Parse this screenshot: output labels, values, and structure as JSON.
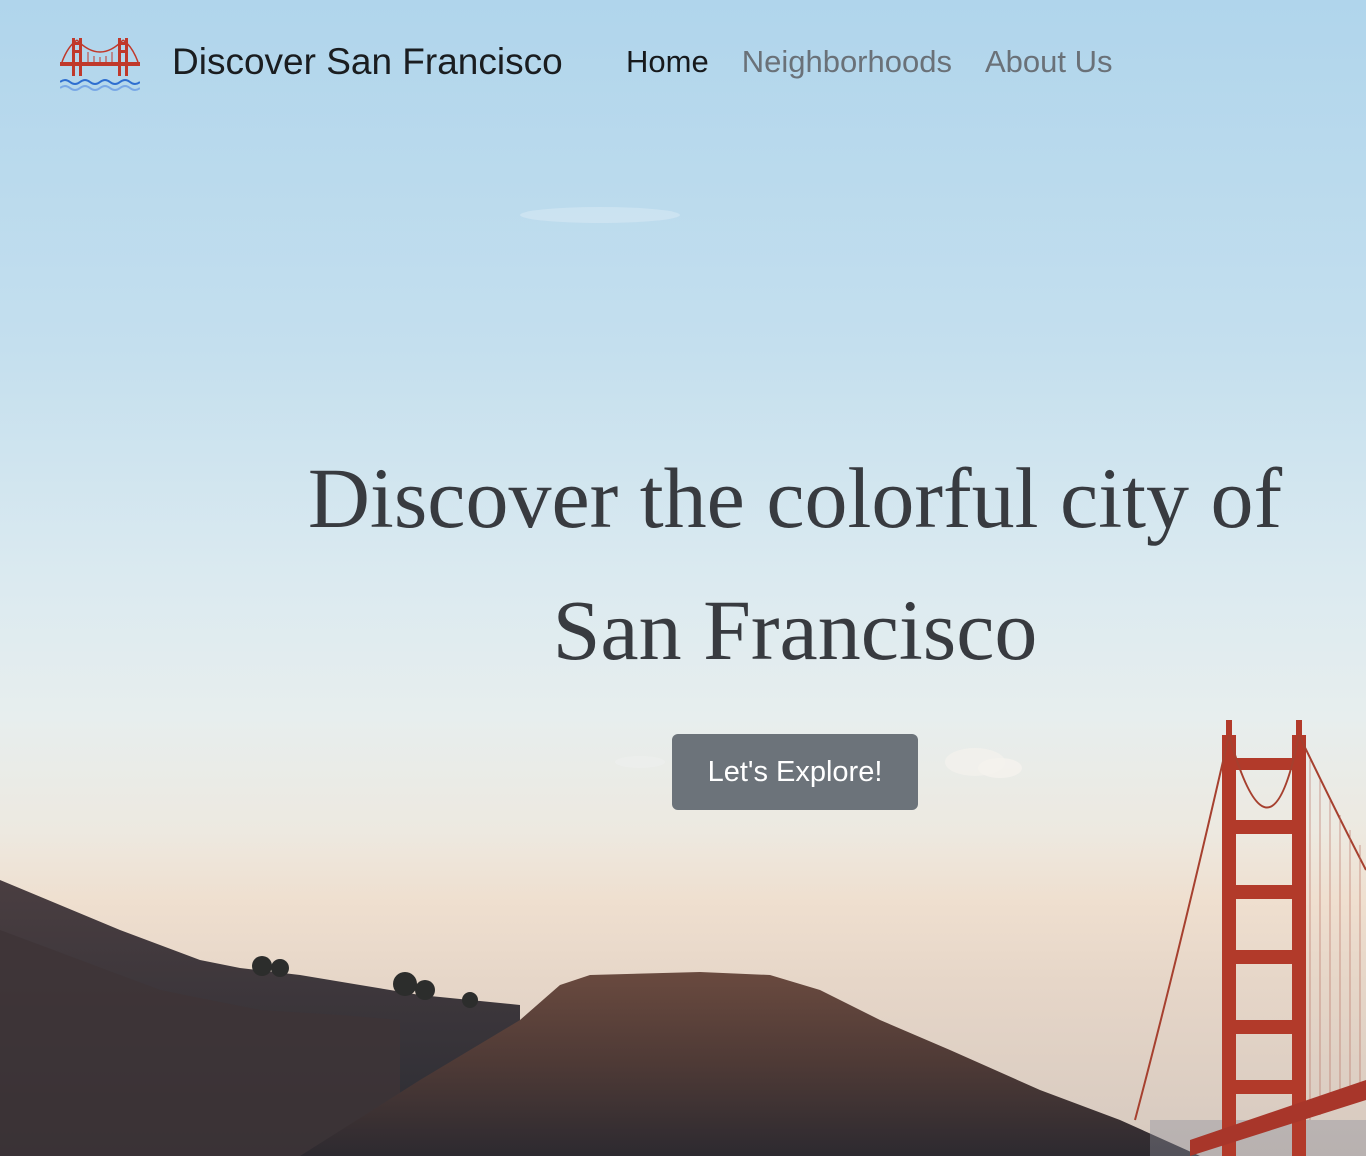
{
  "navbar": {
    "brand_label": "Discover San Francisco",
    "brand_icon": "golden-gate-bridge-icon",
    "links": [
      {
        "label": "Home",
        "active": true
      },
      {
        "label": "Neighborhoods",
        "active": false
      },
      {
        "label": "About Us",
        "active": false
      }
    ]
  },
  "hero": {
    "heading": "Discover the colorful city of San Francisco",
    "cta_label": "Let's Explore!",
    "background": "golden-gate-bridge-and-hills-photo"
  },
  "colors": {
    "brand_text": "#1a1d20",
    "nav_active": "#16191c",
    "nav_inactive": "#6a7178",
    "heading": "#383b40",
    "button_bg": "#6c737a",
    "button_text": "#ffffff",
    "bridge_red": "#b23a2a",
    "sky_top": "#b0d5ec"
  }
}
